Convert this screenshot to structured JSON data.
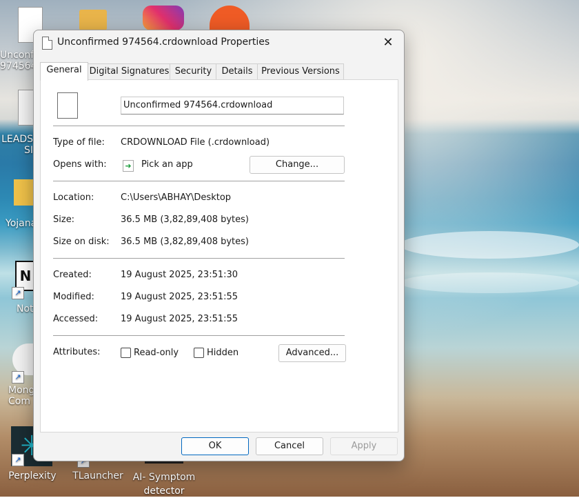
{
  "desktop": {
    "icons": [
      {
        "label": "Unconfi\n974564",
        "icon": "file-icon"
      },
      {
        "label": "",
        "icon": "powerpoint-folder-icon"
      },
      {
        "label": "",
        "icon": "instagram-icon"
      },
      {
        "label": "",
        "icon": "postman-icon"
      },
      {
        "label": "LEADS\nSI",
        "icon": "document-icon"
      },
      {
        "label": "Yojana",
        "icon": "folder-icon"
      },
      {
        "label": "Not",
        "icon": "notion-icon"
      },
      {
        "label": "Mong\nCom",
        "icon": "mongodb-compass-icon"
      },
      {
        "label": "Perplexity",
        "icon": "perplexity-icon"
      },
      {
        "label": "TLauncher",
        "icon": "tlauncher-icon"
      },
      {
        "label": "AI- Symptom\ndetector",
        "icon": "app-icon"
      }
    ]
  },
  "dialog": {
    "title": "Unconfirmed 974564.crdownload Properties",
    "tabs": [
      "General",
      "Digital Signatures",
      "Security",
      "Details",
      "Previous Versions"
    ],
    "active_tab": "General",
    "filename_value": "Unconfirmed 974564.crdownload",
    "type_label": "Type of file:",
    "type_value": "CRDOWNLOAD File (.crdownload)",
    "opens_label": "Opens with:",
    "opens_value": "Pick an app",
    "change_button": "Change...",
    "location_label": "Location:",
    "location_value": "C:\\Users\\ABHAY\\Desktop",
    "size_label": "Size:",
    "size_value": "36.5 MB (3,82,89,408 bytes)",
    "size_on_disk_label": "Size on disk:",
    "size_on_disk_value": "36.5 MB (3,82,89,408 bytes)",
    "created_label": "Created:",
    "created_value": "19 August 2025, 23:51:30",
    "modified_label": "Modified:",
    "modified_value": "19 August 2025, 23:51:55",
    "accessed_label": "Accessed:",
    "accessed_value": "19 August 2025, 23:51:55",
    "attributes_label": "Attributes:",
    "readonly_label": "Read-only",
    "hidden_label": "Hidden",
    "advanced_button": "Advanced...",
    "ok_button": "OK",
    "cancel_button": "Cancel",
    "apply_button": "Apply",
    "close_glyph": "✕"
  },
  "colors": {
    "accent": "#0067c0",
    "dialog_bg": "#f3f3f3",
    "panel_bg": "#ffffff"
  }
}
